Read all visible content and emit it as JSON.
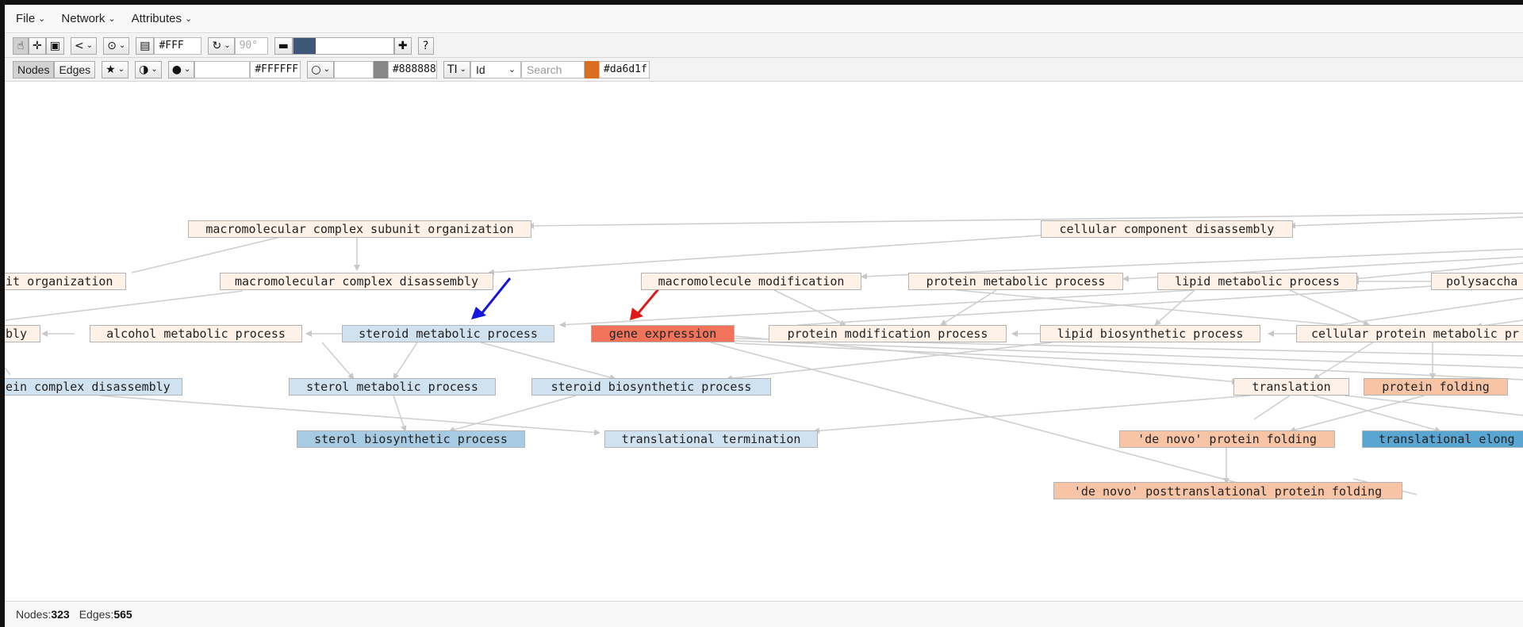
{
  "menu": {
    "file": "File",
    "network": "Network",
    "attributes": "Attributes"
  },
  "toolbar1": {
    "background_color": "#FFF",
    "rotation": "90°",
    "zoom_level_fraction": 0.22
  },
  "toolbar2": {
    "nodes_tab": "Nodes",
    "edges_tab": "Edges",
    "fill_color": "#FFFFFF",
    "border_color": "#888888",
    "label_attribute": "Id",
    "search_placeholder": "Search",
    "highlight_color": "#da6d1f"
  },
  "colors": {
    "toolbar_bg": "#f3f3f3",
    "menu_bg": "#f8f8f8",
    "node_peach": "#fdf1e8",
    "node_light_blue": "#d0e1f0",
    "node_mid_blue": "#a8cbe4",
    "node_salmon": "#f8c4a6",
    "node_red": "#f0735a",
    "node_blue": "#5aa6d2",
    "edge": "#cccccc",
    "arrow_blue": "#1515e0",
    "arrow_red": "#e01818"
  },
  "nodes": [
    {
      "id": "macromolecular complex subunit organization"
    },
    {
      "id": "cellular component disassembly"
    },
    {
      "id": "it organization"
    },
    {
      "id": "macromolecular complex disassembly"
    },
    {
      "id": "macromolecule modification"
    },
    {
      "id": "protein metabolic process"
    },
    {
      "id": "lipid metabolic process"
    },
    {
      "id": "polysaccha"
    },
    {
      "id": "bly"
    },
    {
      "id": "alcohol metabolic process"
    },
    {
      "id": "steroid metabolic process"
    },
    {
      "id": "gene expression"
    },
    {
      "id": "protein modification process"
    },
    {
      "id": "lipid biosynthetic process"
    },
    {
      "id": "cellular protein metabolic pr"
    },
    {
      "id": "ein complex disassembly"
    },
    {
      "id": "sterol metabolic process"
    },
    {
      "id": "steroid biosynthetic process"
    },
    {
      "id": "translation"
    },
    {
      "id": "protein folding"
    },
    {
      "id": "sterol biosynthetic process"
    },
    {
      "id": "translational termination"
    },
    {
      "id": "'de novo' protein folding"
    },
    {
      "id": "translational elong"
    },
    {
      "id": "'de novo' posttranslational protein folding"
    }
  ],
  "status": {
    "nodes_label": "Nodes:",
    "nodes_count": "323",
    "edges_label": "Edges:",
    "edges_count": "565"
  }
}
